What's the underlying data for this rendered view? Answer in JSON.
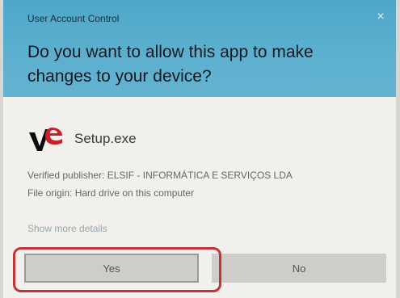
{
  "window": {
    "title": "User Account Control",
    "close_glyph": "×"
  },
  "prompt": {
    "question": "Do you want to allow this app to make changes to your device?"
  },
  "app": {
    "name": "Setup.exe",
    "icon": "ve-app-icon"
  },
  "info": {
    "publisher": "Verified publisher: ELSIF - INFORMÁTICA E SERVIÇOS LDA",
    "origin": "File origin: Hard drive on this computer"
  },
  "links": {
    "more_details": "Show more details"
  },
  "buttons": {
    "yes": "Yes",
    "no": "No"
  },
  "colors": {
    "header": "#5db0cf",
    "body": "#f1f0ec",
    "button": "#cfcdca",
    "highlight": "#c43336"
  }
}
